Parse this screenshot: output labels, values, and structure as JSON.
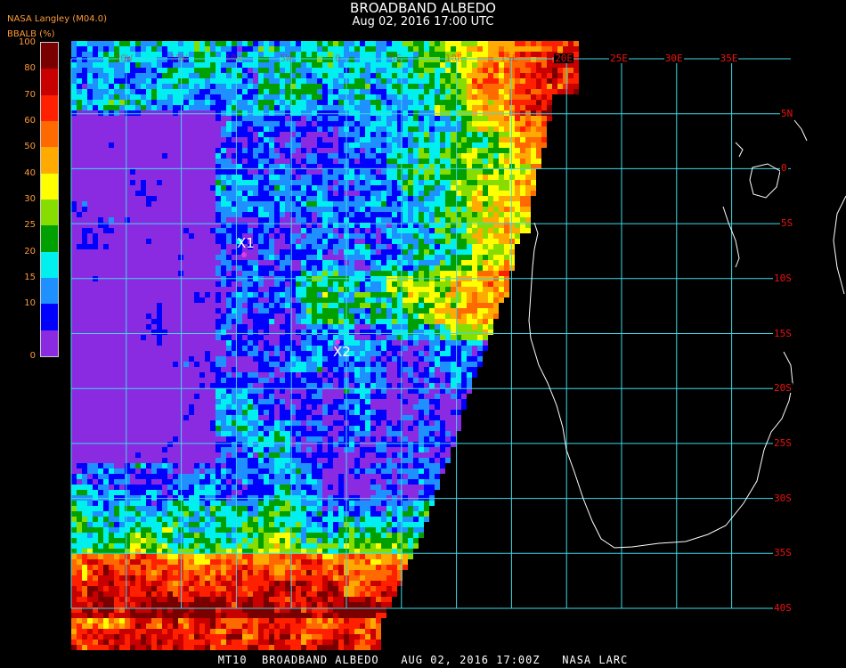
{
  "header": {
    "title": "BROADBAND ALBEDO",
    "datetime": "Aug 02, 2016 17:00 UTC",
    "organization": "NASA Langley (M04.0)",
    "variable_label": "BBALB (%)"
  },
  "colorbar": {
    "labels": [
      "100",
      "80",
      "70",
      "60",
      "50",
      "40",
      "30",
      "25",
      "20",
      "15",
      "10",
      "0"
    ],
    "colors": [
      "#7a0000",
      "#c80000",
      "#ff2000",
      "#ff6a00",
      "#ffaa00",
      "#ffff00",
      "#88dd00",
      "#00a000",
      "#00f0f0",
      "#1e90ff",
      "#0000ff",
      "#8a2be2"
    ]
  },
  "map": {
    "grid_color": "#40d8e8",
    "label_color": "#ee1111",
    "lat_labels": [
      "5N",
      "0",
      "5S",
      "10S",
      "15S",
      "20S",
      "25S",
      "30S",
      "35S",
      "40S"
    ],
    "lon_labels": [
      "20E",
      "25E",
      "30E",
      "35E"
    ],
    "faint_lon_labels": [
      "20W",
      "15W",
      "10W",
      "5W",
      "0",
      "5E",
      "10E",
      "15E"
    ],
    "markers": [
      {
        "label": "X1"
      },
      {
        "label": "X2"
      }
    ],
    "marker_color": "#e03ae0"
  },
  "footer": {
    "caption": "MT10  BROADBAND ALBEDO   AUG 02, 2016 17:00Z   NASA LARC"
  }
}
